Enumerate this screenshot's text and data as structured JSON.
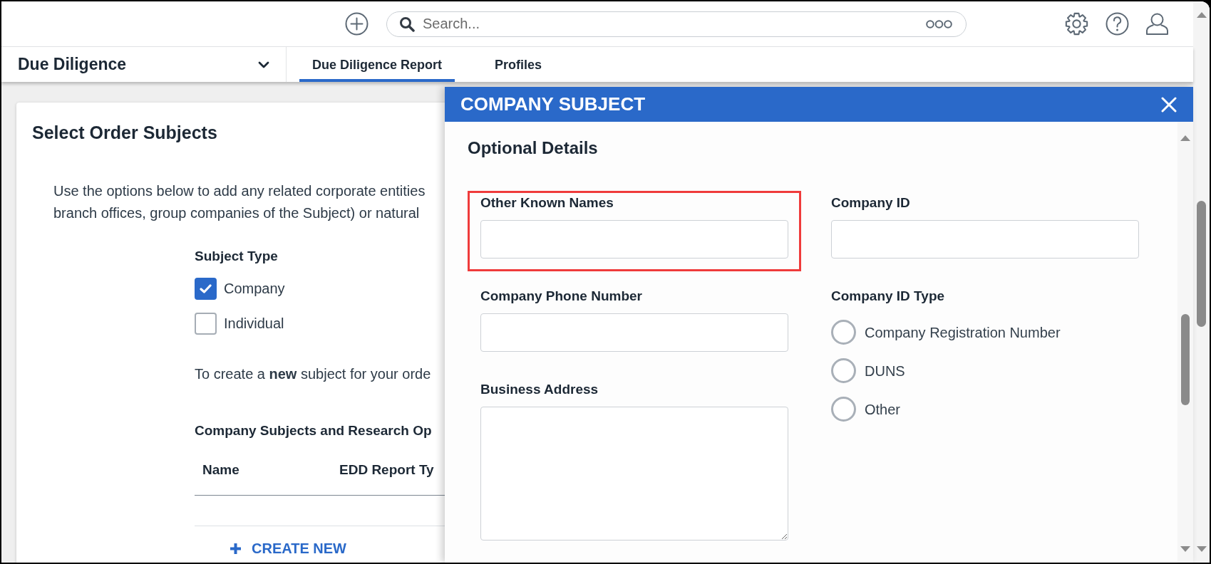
{
  "top_bar": {
    "search": {
      "placeholder": "Search..."
    }
  },
  "nav": {
    "app_title": "Due Diligence",
    "tabs": [
      {
        "label": "Due Diligence Report",
        "selected": true
      },
      {
        "label": "Profiles",
        "selected": false
      }
    ]
  },
  "order_subjects": {
    "title": "Select Order Subjects",
    "intro_lines": [
      "Use the options below to add any related corporate entities",
      "branch offices, group companies of the Subject) or natural"
    ],
    "subject_type": {
      "label": "Subject Type",
      "options": [
        {
          "label": "Company",
          "checked": true
        },
        {
          "label": "Individual",
          "checked": false
        }
      ]
    },
    "create_hint": "To create a **new** subject for your orde",
    "table": {
      "title": "Company Subjects and Research Op",
      "columns": [
        "Name",
        "EDD Report Ty"
      ]
    },
    "create_button": {
      "label": "CREATE NEW"
    }
  },
  "modal": {
    "title": "COMPANY SUBJECT",
    "section_title": "Optional Details",
    "left_fields": [
      {
        "kind": "input",
        "label": "Other Known Names",
        "highlighted": true
      },
      {
        "kind": "input",
        "label": "Company Phone Number",
        "highlighted": false
      },
      {
        "kind": "textarea",
        "label": "Business Address",
        "highlighted": false
      }
    ],
    "right_fields": [
      {
        "kind": "input",
        "label": "Company ID",
        "highlighted": false
      },
      {
        "kind": "radios",
        "label": "Company ID Type",
        "highlighted": false,
        "options": [
          {
            "label": "Company Registration Number",
            "selected": false
          },
          {
            "label": "DUNS",
            "selected": false
          },
          {
            "label": "Other",
            "selected": false
          }
        ]
      }
    ]
  }
}
